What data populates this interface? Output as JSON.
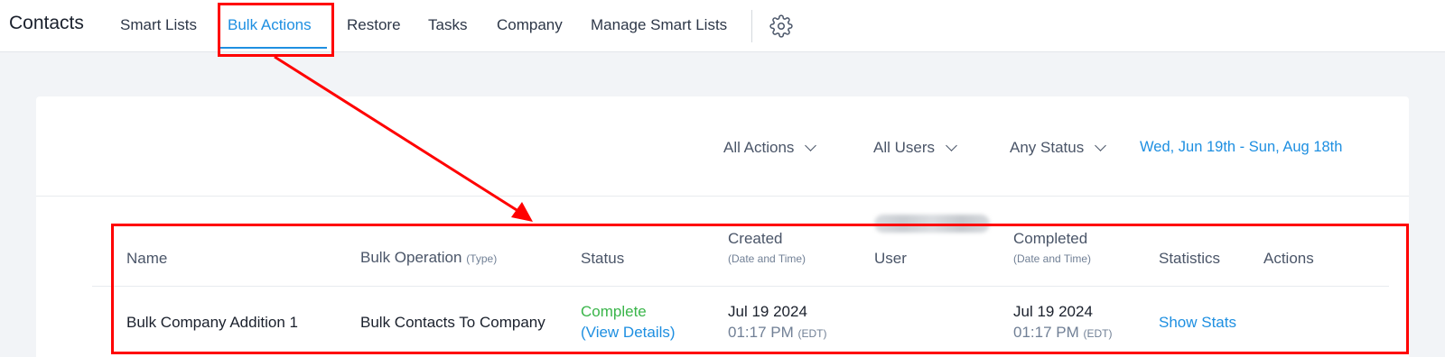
{
  "header": {
    "title": "Contacts",
    "nav": [
      {
        "label": "Smart Lists",
        "active": false
      },
      {
        "label": "Bulk Actions",
        "active": true
      },
      {
        "label": "Restore",
        "active": false
      },
      {
        "label": "Tasks",
        "active": false
      },
      {
        "label": "Company",
        "active": false
      },
      {
        "label": "Manage Smart Lists",
        "active": false
      }
    ],
    "settings_icon": "gear-icon"
  },
  "filters": {
    "actions": "All Actions",
    "users": "All Users",
    "status": "Any Status",
    "date_range": "Wed, Jun 19th - Sun, Aug 18th"
  },
  "table": {
    "columns": {
      "name": "Name",
      "operation": "Bulk Operation",
      "operation_sub": "(Type)",
      "status": "Status",
      "created": "Created",
      "created_sub": "(Date and Time)",
      "user": "User",
      "completed": "Completed",
      "completed_sub": "(Date and Time)",
      "statistics": "Statistics",
      "actions": "Actions"
    },
    "rows": [
      {
        "name": "Bulk Company Addition 1",
        "operation": "Bulk Contacts To Company",
        "status": "Complete",
        "status_link": "(View Details)",
        "created_date": "Jul 19 2024",
        "created_time": "01:17 PM",
        "created_tz": "(EDT)",
        "completed_date": "Jul 19 2024",
        "completed_time": "01:17 PM",
        "completed_tz": "(EDT)",
        "statistics_link": "Show Stats"
      }
    ]
  },
  "colors": {
    "accent": "#1e8fe1",
    "status_complete": "#3ab54a",
    "annotation": "#ff0000"
  }
}
